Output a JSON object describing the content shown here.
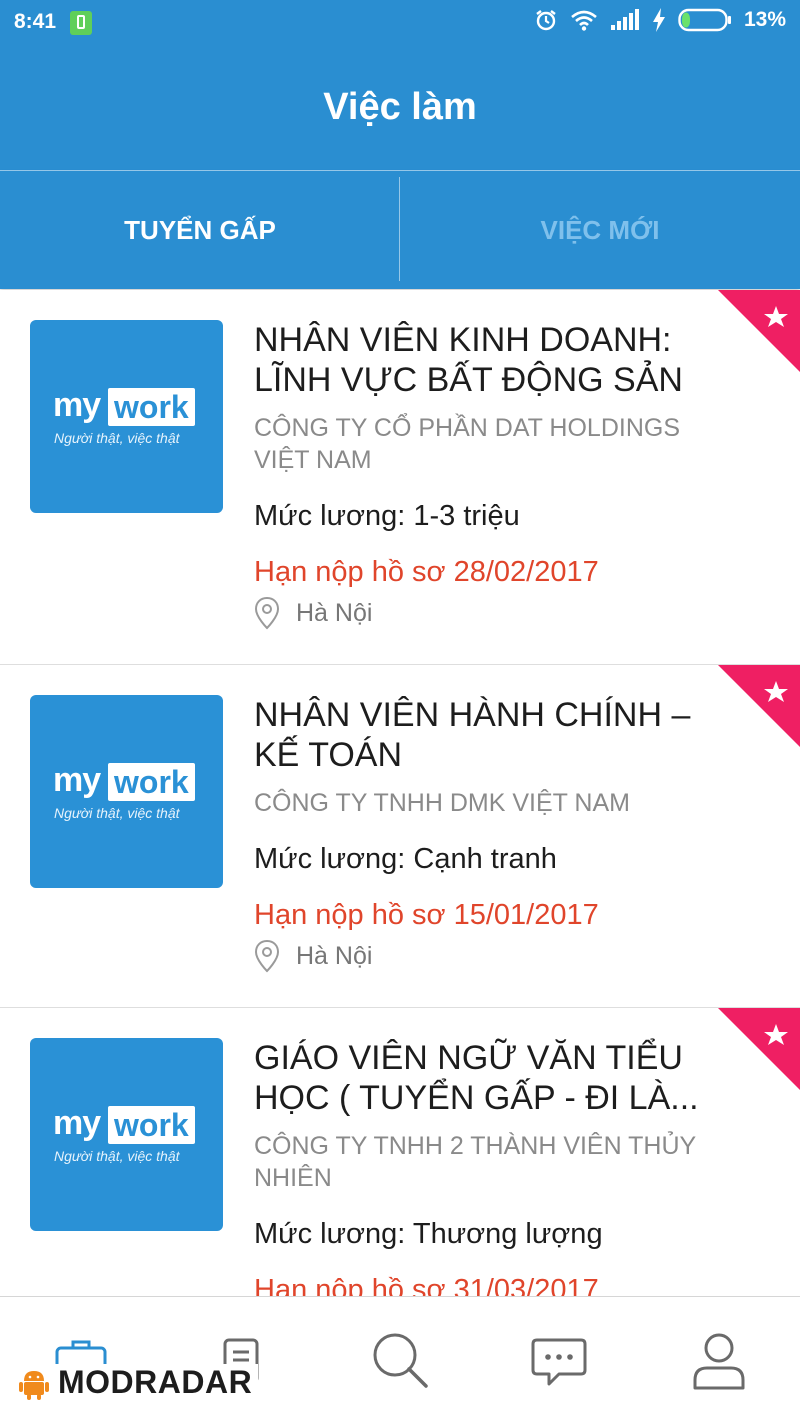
{
  "status_bar": {
    "time": "8:41",
    "battery": "13%",
    "icons": [
      "app-notification-icon",
      "alarm-icon",
      "wifi-icon",
      "signal-icon",
      "charging-icon",
      "battery-icon"
    ]
  },
  "header": {
    "title": "Việc làm"
  },
  "tabs": [
    {
      "label": "TUYỂN GẤP",
      "active": true
    },
    {
      "label": "VIỆC MỚI",
      "active": false
    }
  ],
  "jobs": [
    {
      "logo": {
        "my": "my",
        "work": "work",
        "slogan": "Người thật, việc thật"
      },
      "title": "NHÂN VIÊN KINH DOANH: LĨNH VỰC BẤT ĐỘNG SẢN",
      "company": "CÔNG TY CỔ PHẦN DAT HOLDINGS VIỆT NAM",
      "salary": "Mức lương: 1-3 triệu",
      "deadline": "Hạn nộp hồ sơ 28/02/2017",
      "location": "Hà Nội",
      "featured": true
    },
    {
      "logo": {
        "my": "my",
        "work": "work",
        "slogan": "Người thật, việc thật"
      },
      "title": "NHÂN VIÊN HÀNH CHÍNH – KẾ TOÁN",
      "company": "CÔNG TY TNHH DMK VIỆT NAM",
      "salary": "Mức lương: Cạnh tranh",
      "deadline": "Hạn nộp hồ sơ 15/01/2017",
      "location": "Hà Nội",
      "featured": true
    },
    {
      "logo": {
        "my": "my",
        "work": "work",
        "slogan": "Người thật, việc thật"
      },
      "title": "GIÁO VIÊN NGỮ VĂN TIỂU HỌC ( TUYỂN GẤP - ĐI LÀ...",
      "company": "CÔNG TY TNHH 2 THÀNH VIÊN THỦY NHIÊN",
      "salary": "Mức lương: Thương lượng",
      "deadline": "Hạn nộp hồ sơ 31/03/2017",
      "location": "",
      "featured": true
    }
  ],
  "bottom_nav": [
    "jobs-briefcase-icon",
    "saved-jobs-icon",
    "search-icon",
    "messages-icon",
    "profile-icon"
  ],
  "watermark": {
    "text": "MODRADAR"
  },
  "colors": {
    "primary": "#2a8ed1",
    "accent_red": "#e0452b",
    "ribbon_pink": "#ef1f63",
    "inactive_tab": "#7fc0ec"
  }
}
